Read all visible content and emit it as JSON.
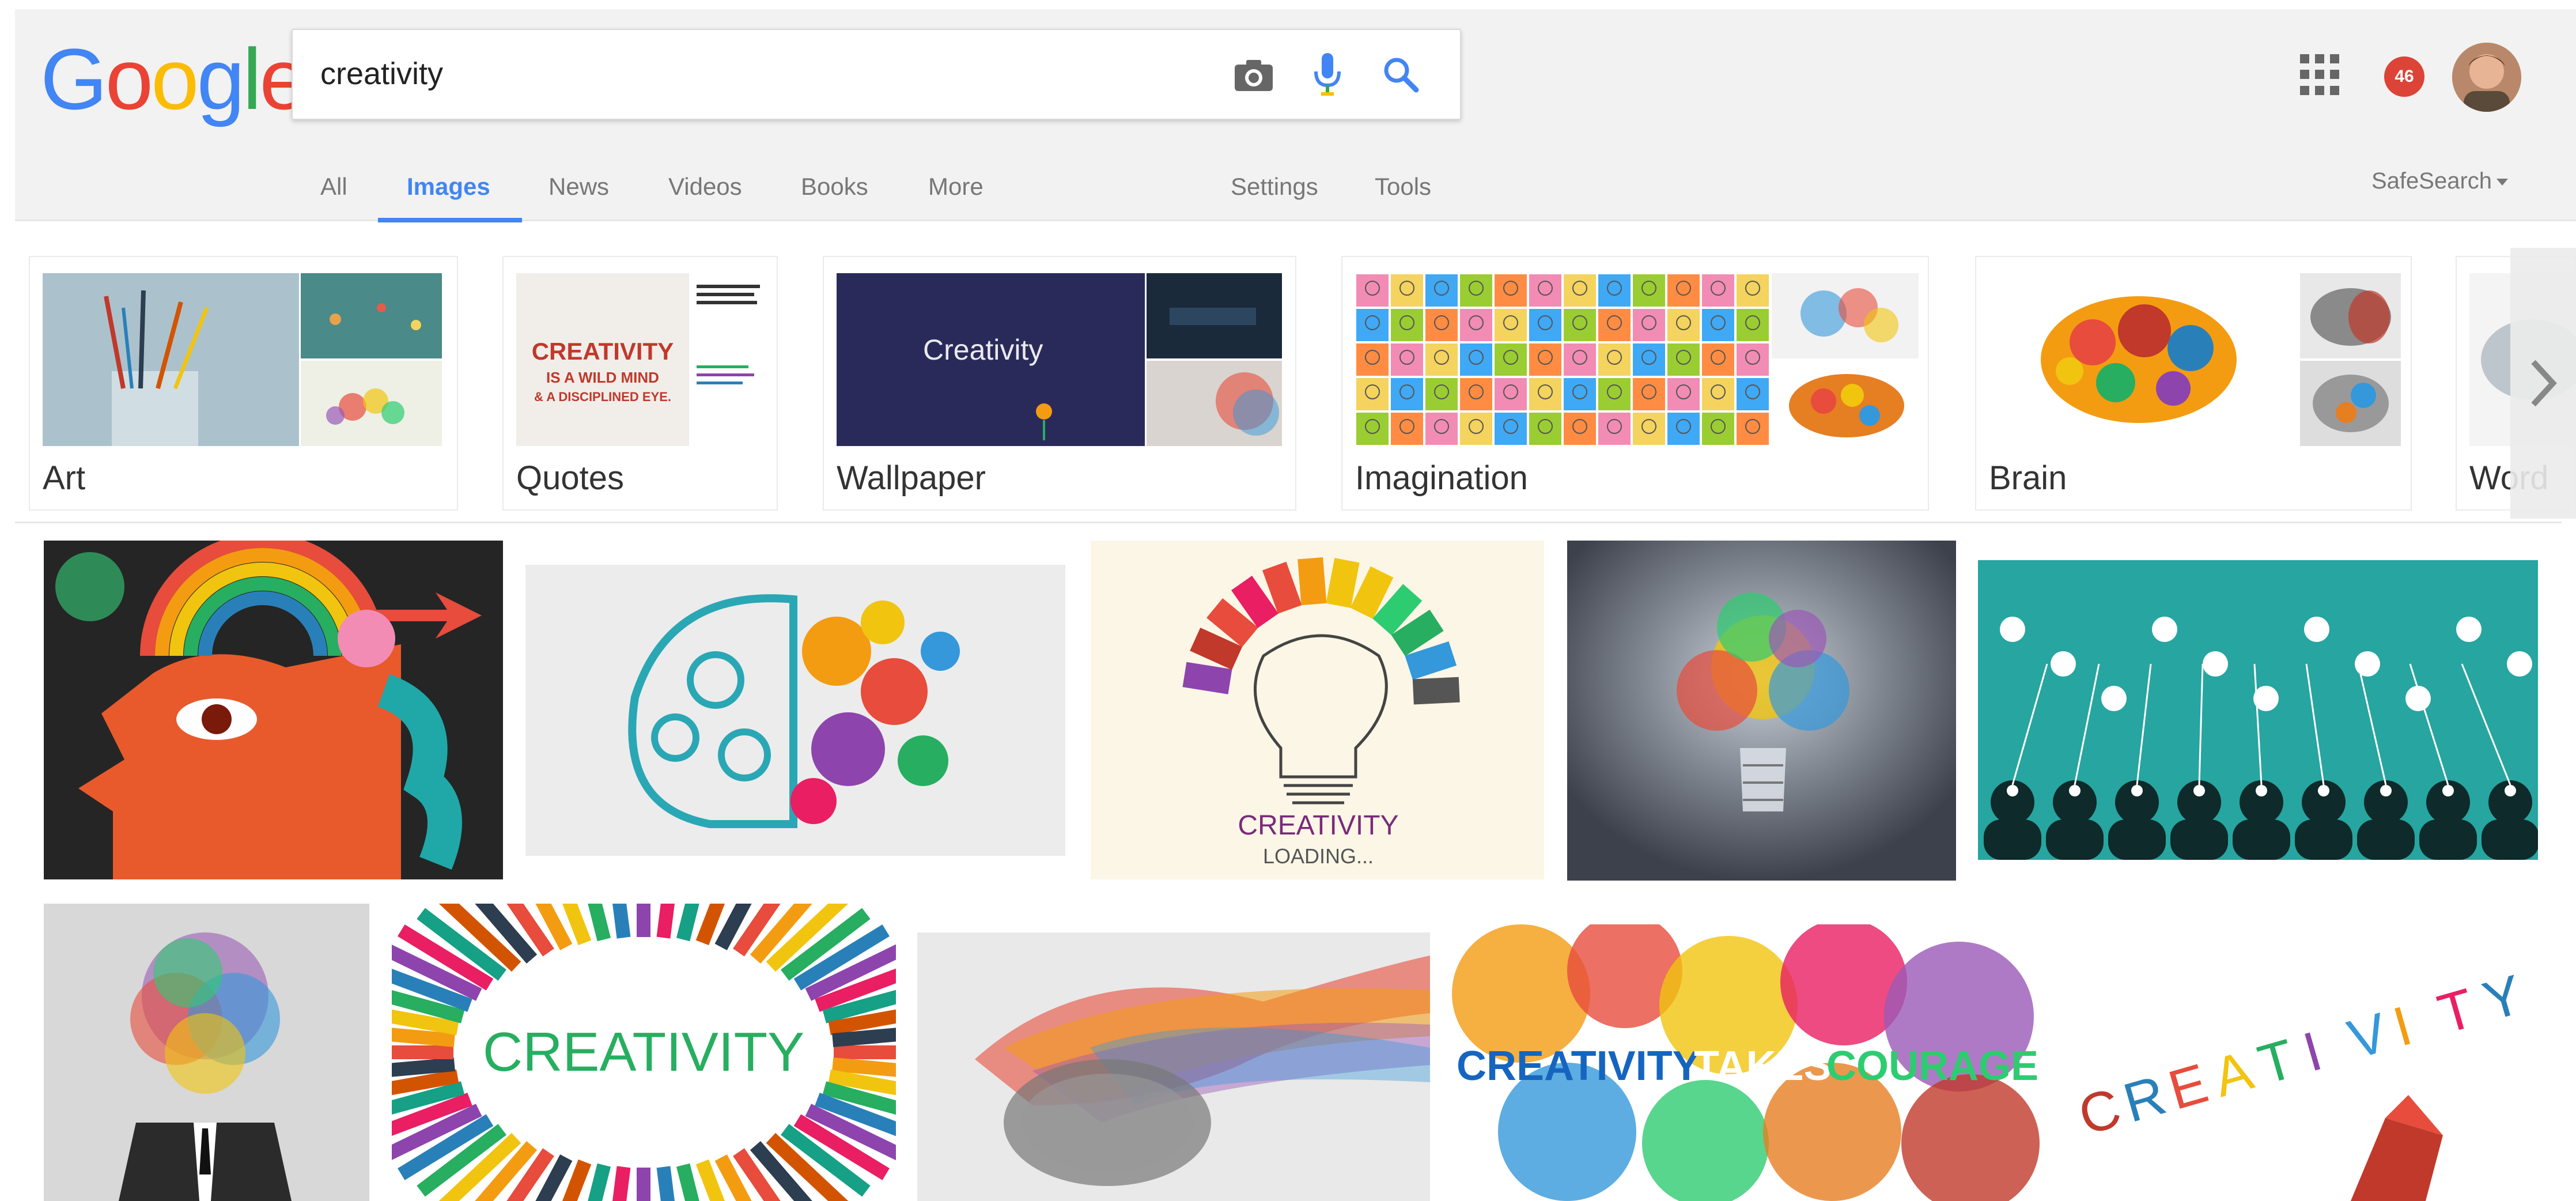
{
  "brand": {
    "logo_letters": [
      "G",
      "o",
      "o",
      "g",
      "l",
      "e"
    ],
    "logo_colors": [
      "#4285f4",
      "#ea4335",
      "#fbbc05",
      "#4285f4",
      "#34a853",
      "#ea4335"
    ]
  },
  "search": {
    "query": "creativity"
  },
  "header": {
    "notification_count": "46"
  },
  "tabs": [
    {
      "label": "All",
      "active": false
    },
    {
      "label": "Images",
      "active": true
    },
    {
      "label": "News",
      "active": false
    },
    {
      "label": "Videos",
      "active": false
    },
    {
      "label": "Books",
      "active": false
    },
    {
      "label": "More",
      "active": false
    },
    {
      "label": "Settings",
      "active": false
    },
    {
      "label": "Tools",
      "active": false
    }
  ],
  "safesearch": {
    "label": "SafeSearch"
  },
  "related": [
    {
      "label": "Art"
    },
    {
      "label": "Quotes"
    },
    {
      "label": "Wallpaper"
    },
    {
      "label": "Imagination"
    },
    {
      "label": "Brain"
    },
    {
      "label": "Word"
    }
  ],
  "image_text": {
    "quotes_headline": "CREATIVITY IS A WILD MIND & A DISCIPLINED EYE.",
    "wallpaper_word": "Creativity",
    "bulb_caption_1": "CREATIVITY",
    "bulb_caption_2": "LOADING...",
    "pencils_word": "CREATIVITY",
    "courage_1": "CREATIVITY",
    "courage_2": "TAKES",
    "courage_3": "COURAGE",
    "crayon_word": "CREATIVITY"
  },
  "colors": {
    "accent": "#4285f4",
    "badge": "#db4437",
    "header_bg": "#f2f2f2"
  }
}
